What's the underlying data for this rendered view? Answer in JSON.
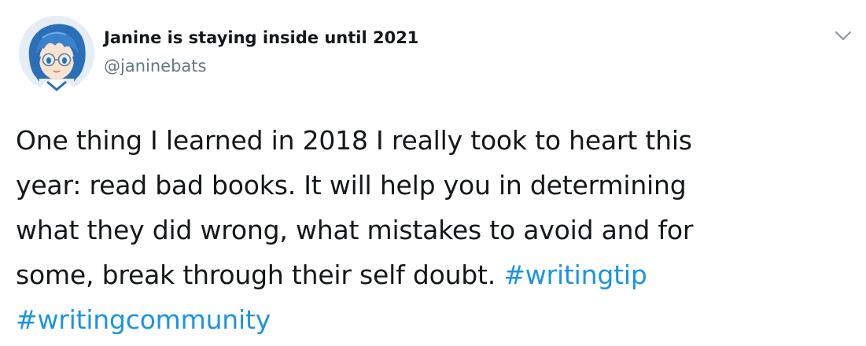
{
  "author": {
    "display_name": "Janine is staying inside until 2021",
    "handle": "@janinebats"
  },
  "icons": {
    "avatar": "anime-girl-avatar",
    "menu": "chevron-down-icon"
  },
  "colors": {
    "text": "#14171a",
    "secondary_text": "#657786",
    "link": "#1b95e0",
    "chevron": "#8899a6"
  },
  "tweet": {
    "lines": [
      "One thing I learned in 2018 I really took to heart this",
      "year: read bad books. It will help you in determining",
      "what they did wrong, what mistakes to avoid and for",
      "some, break through their self doubt. "
    ],
    "hashtags": [
      "#writingtip",
      "#writingcommunity"
    ]
  }
}
